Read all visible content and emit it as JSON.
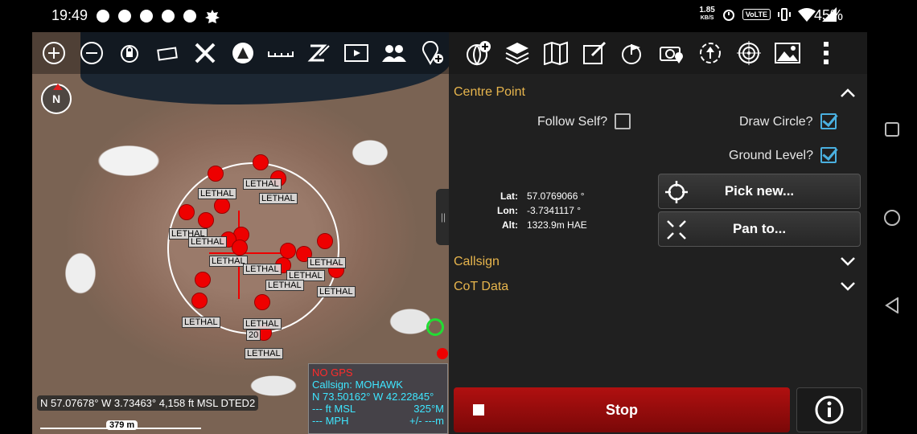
{
  "status_bar": {
    "time": "19:49",
    "net_speed_value": "1.85",
    "net_speed_unit": "KB/S",
    "volte": "VoLTE",
    "battery": "45%"
  },
  "map": {
    "north_label": "N",
    "coordinates": "N 57.07678°  W 3.73463°  4,158 ft MSL DTED2",
    "scale": "379 m",
    "marker_label": "LETHAL",
    "marker_label_partial": "20",
    "self": {
      "no_gps": "NO GPS",
      "callsign": "Callsign: MOHAWK",
      "position": "N 73.50162°  W 42.22845°",
      "altitude": "--- ft MSL",
      "heading": "325°M",
      "speed": "--- MPH",
      "accuracy": "+/- ---m"
    }
  },
  "panel": {
    "centre_point": "Centre Point",
    "follow_self_label": "Follow Self?",
    "follow_self_checked": false,
    "draw_circle_label": "Draw Circle?",
    "draw_circle_checked": true,
    "ground_level_label": "Ground Level?",
    "ground_level_checked": true,
    "lat_label": "Lat:",
    "lat_value": "57.0769066 °",
    "lon_label": "Lon:",
    "lon_value": "-3.7341117 °",
    "alt_label": "Alt:",
    "alt_value": "1323.9m HAE",
    "pick_new": "Pick new...",
    "pan_to": "Pan to...",
    "callsign_section": "Callsign",
    "cot_section": "CoT Data",
    "stop": "Stop"
  },
  "colors": {
    "accent_orange": "#e7b54d",
    "stop_red": "#b01010",
    "check_blue": "#4ab0e0",
    "marker_red": "#e00000",
    "self_cyan": "#3ee6ff"
  }
}
